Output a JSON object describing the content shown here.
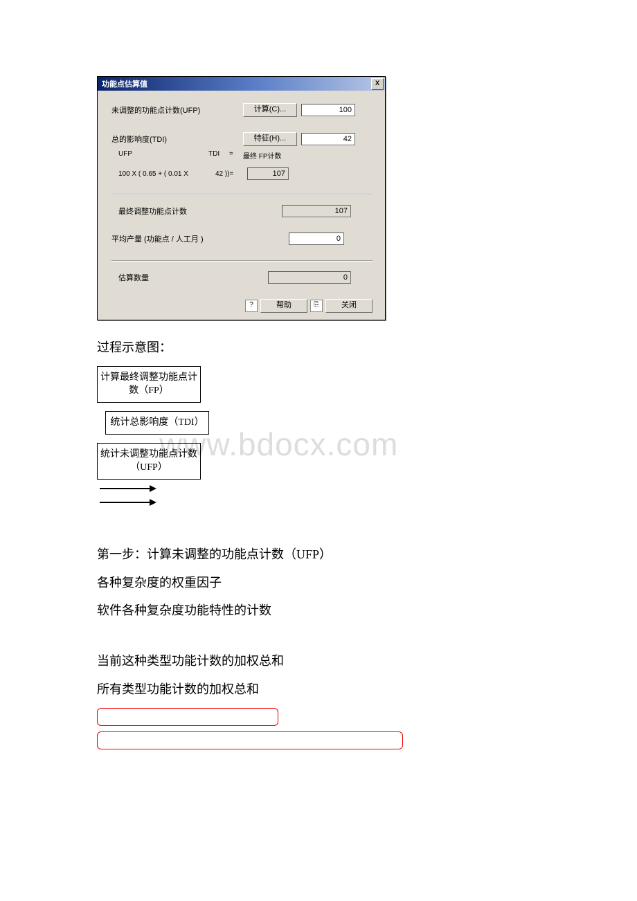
{
  "dialog": {
    "title": "功能点估算值",
    "close": "X",
    "ufp_label": "未调整的功能点计数(UFP)",
    "calc_btn": "计算(C)...",
    "ufp_value": "100",
    "tdi_label": "总的影响度(TDI)",
    "feature_btn": "特征(H)...",
    "tdi_value": "42",
    "ufp_h": "UFP",
    "tdi_h": "TDI",
    "eq": "=",
    "fp_h": "最终 FP计数",
    "formula_a": "100 X (  0.65   +    ( 0.01  X",
    "formula_b": "42  ))=",
    "fp_value": "107",
    "final_label": "最终调整功能点计数",
    "final_value": "107",
    "avg_label": "平均产量 (功能点 / 人工月 )",
    "avg_value": "0",
    "est_label": "估算数量",
    "est_value": "0",
    "help_btn": "帮助",
    "close_btn": "关闭"
  },
  "doc": {
    "caption": "过程示意图：",
    "box1": "计算最终调整功能点计数（FP）",
    "box2": "统计总影响度（TDI）",
    "box3": "统计未调整功能点计数（UFP）",
    "step1": "第一步：计算未调整的功能点计数（UFP）",
    "line2": "各种复杂度的权重因子",
    "line3": "软件各种复杂度功能特性的计数",
    "line4": "当前这种类型功能计数的加权总和",
    "line5": "所有类型功能计数的加权总和"
  },
  "watermark": "www.bdocx.com"
}
